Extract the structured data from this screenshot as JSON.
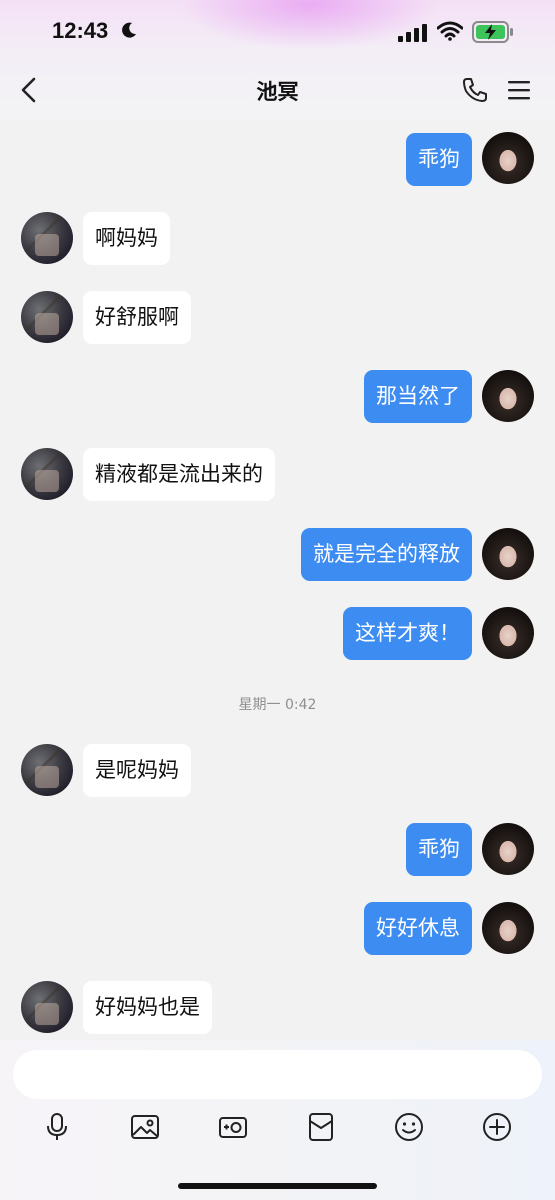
{
  "status_bar": {
    "time": "12:43"
  },
  "header": {
    "title": "池冥"
  },
  "time_separator": "星期一 0:42",
  "messages": [
    {
      "side": "me",
      "text": "乖狗"
    },
    {
      "side": "other",
      "text": "啊妈妈"
    },
    {
      "side": "other",
      "text": "好舒服啊"
    },
    {
      "side": "me",
      "text": "那当然了"
    },
    {
      "side": "other",
      "text": "精液都是流出来的"
    },
    {
      "side": "me",
      "text": "就是完全的释放"
    },
    {
      "side": "me",
      "text": "这样才爽！"
    },
    {
      "side": "other",
      "text": "是呢妈妈"
    },
    {
      "side": "me",
      "text": "乖狗"
    },
    {
      "side": "me",
      "text": "好好休息"
    },
    {
      "side": "other",
      "text": "好妈妈也是"
    }
  ],
  "toolbar": {
    "icons": [
      "microphone-icon",
      "image-icon",
      "camera-icon",
      "red-packet-icon",
      "emoji-icon",
      "plus-icon"
    ]
  },
  "colors": {
    "my_bubble": "#3d8cf2",
    "other_bubble": "#ffffff",
    "chat_bg": "#f2f2f2"
  }
}
